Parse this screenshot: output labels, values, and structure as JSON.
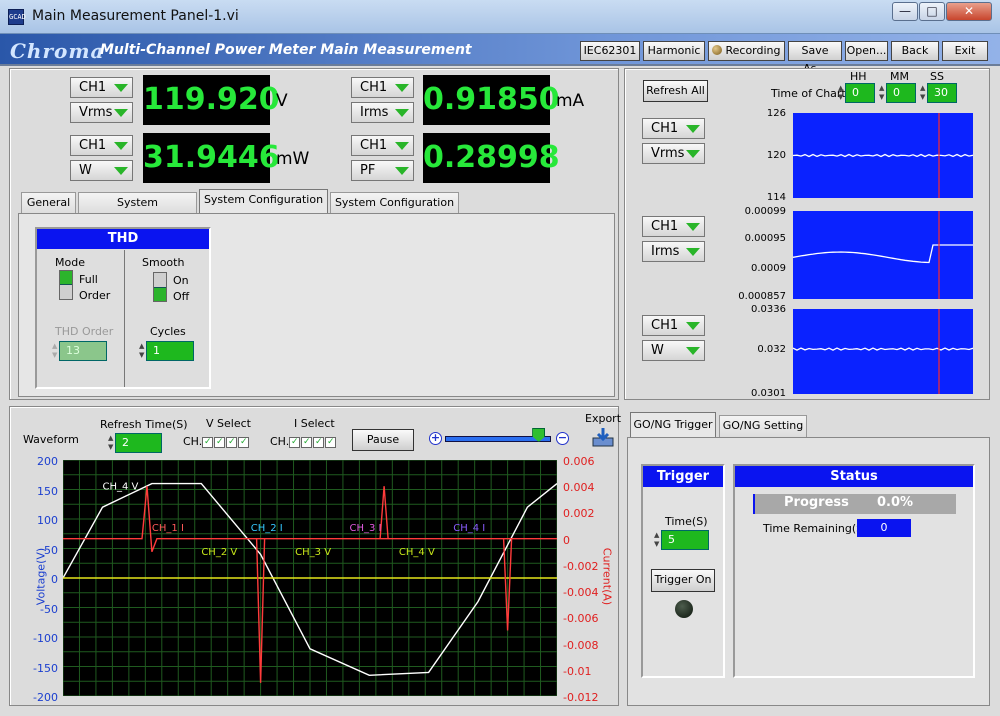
{
  "window": {
    "title": "Main Measurement Panel-1.vi",
    "app_icon": "GCAD",
    "min": "—",
    "max": "□",
    "close": "✕"
  },
  "banner": {
    "logo": "Chroma",
    "title": "Multi-Channel Power Meter Main Measurement",
    "buttons": [
      "IEC62301",
      "Harmonic",
      "Recording",
      "Save As...",
      "Open...",
      "Back",
      "Exit"
    ]
  },
  "meters": [
    {
      "ch": "CH1",
      "param": "Vrms",
      "value": "119.920",
      "unit": "V"
    },
    {
      "ch": "CH1",
      "param": "Irms",
      "value": "0.91850",
      "unit": "mA"
    },
    {
      "ch": "CH1",
      "param": "W",
      "value": "31.9446",
      "unit": "mW"
    },
    {
      "ch": "CH1",
      "param": "PF",
      "value": "0.28998",
      "unit": ""
    }
  ],
  "config_tabs": [
    "General",
    "System Configuration",
    "System Configuration 1",
    "System Configuration 2"
  ],
  "thd": {
    "header": "THD",
    "mode_label": "Mode",
    "mode_opts": [
      "Full",
      "Order"
    ],
    "mode_selected": "Full",
    "smooth_label": "Smooth",
    "smooth_opts": [
      "On",
      "Off"
    ],
    "smooth_selected": "Off",
    "order_label": "THD Order",
    "order_value": "13",
    "cycles_label": "Cycles",
    "cycles_value": "1"
  },
  "trend": {
    "refresh_all": "Refresh All",
    "time_label": "Time of Chart",
    "hh_label": "HH",
    "mm_label": "MM",
    "ss_label": "SS",
    "hh": "0",
    "mm": "0",
    "ss": "30",
    "charts": [
      {
        "ch": "CH1",
        "param": "Vrms",
        "ticks": [
          "126",
          "120",
          "114"
        ],
        "ymin": 114,
        "ymax": 126,
        "level": 120
      },
      {
        "ch": "CH1",
        "param": "Irms",
        "ticks": [
          "0.00099",
          "0.00095",
          "0.0009",
          "0.000857"
        ],
        "ymin": 0.000857,
        "ymax": 0.00099,
        "level": 0.00092
      },
      {
        "ch": "CH1",
        "param": "W",
        "ticks": [
          "0.0336",
          "0.032",
          "0.0301"
        ],
        "ymin": 0.0301,
        "ymax": 0.0336,
        "level": 0.03195
      }
    ]
  },
  "waveform": {
    "title": "Waveform",
    "refresh_label": "Refresh Time(S)",
    "refresh_value": "2",
    "vselect_label": "V Select",
    "iselect_label": "I Select",
    "ch_label": "CH.",
    "check": "✓",
    "pause": "Pause",
    "export": "Export",
    "zoom_in": "+",
    "zoom_out": "−",
    "slider_level": 0.88,
    "ylabel_left": "Voltage(V)",
    "ylabel_right": "Current(A)",
    "vticks": [
      "200",
      "150",
      "100",
      "50",
      "0",
      "-50",
      "-100",
      "-150",
      "-200"
    ],
    "iticks": [
      "0.006",
      "0.004",
      "0.002",
      "0",
      "-0.002",
      "-0.004",
      "-0.006",
      "-0.008",
      "-0.01",
      "-0.012"
    ],
    "trace_labels": [
      "CH_4 V",
      "CH_1 I",
      "CH_2 I",
      "CH_3 I",
      "CH_4 I",
      "CH_2 V",
      "CH_3 V",
      "CH_4 V"
    ]
  },
  "gonogo": {
    "tabs": [
      "GO/NG Trigger",
      "GO/NG Setting"
    ],
    "trigger_header": "Trigger",
    "time_label": "Time(S)",
    "time_value": "5",
    "trigger_on": "Trigger On",
    "status_header": "Status",
    "progress_label": "Progress",
    "progress_value": "0.0%",
    "remaining_label": "Time Remaining(S)=",
    "remaining_value": "0"
  },
  "chart_data": {
    "type": "line",
    "xlabel": "",
    "ylabel": "Voltage(V)",
    "ylabel_right": "Current(A)",
    "ylim": [
      -200,
      200
    ],
    "ylim_right": [
      -0.012,
      0.006
    ],
    "grid": true,
    "series": [
      {
        "name": "CH_4 V",
        "axis": "left",
        "x": [
          0,
          8,
          18,
          28,
          40,
          50,
          62,
          74,
          84,
          94,
          100
        ],
        "values": [
          0,
          120,
          160,
          160,
          40,
          -120,
          -165,
          -160,
          -40,
          120,
          160
        ]
      },
      {
        "name": "CH_1 I",
        "axis": "right",
        "x": [
          0,
          16,
          17,
          18,
          19,
          20,
          100
        ],
        "values": [
          0,
          0,
          0.004,
          -0.001,
          0,
          0,
          0
        ]
      },
      {
        "name": "CH_2 V",
        "axis": "left",
        "x": [
          0,
          100
        ],
        "values": [
          0,
          0
        ]
      }
    ]
  }
}
